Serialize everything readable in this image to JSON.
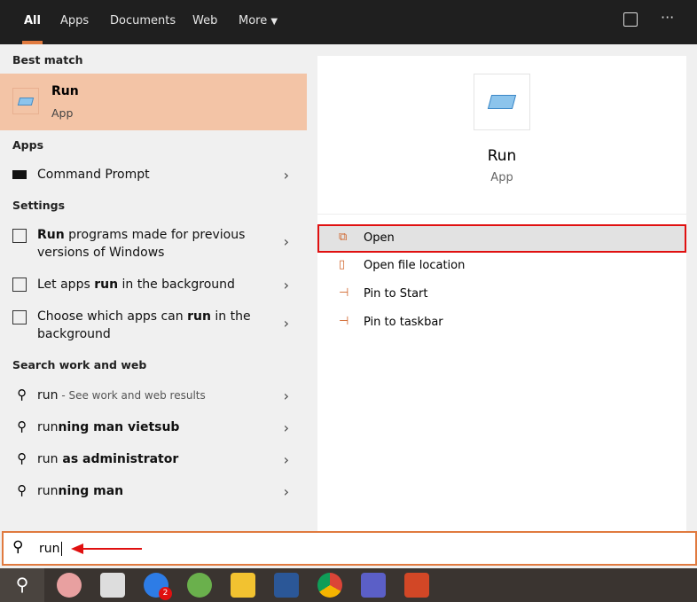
{
  "tabs": [
    "All",
    "Apps",
    "Documents",
    "Web",
    "More"
  ],
  "best_match": {
    "header": "Best match",
    "title": "Run",
    "subtitle": "App"
  },
  "apps": {
    "header": "Apps",
    "items": [
      {
        "label": "Command Prompt"
      }
    ]
  },
  "settings": {
    "header": "Settings",
    "items": [
      {
        "bold": "Run",
        "rest": " programs made for previous",
        "line2": "versions of Windows"
      },
      {
        "pre": "Let apps ",
        "bold": "run",
        "rest": " in the background"
      },
      {
        "pre": "Choose which apps can ",
        "bold": "run",
        "rest": " in the",
        "line2": "background"
      }
    ]
  },
  "web": {
    "header": "Search work and web",
    "items": [
      {
        "pre": "run",
        "bold": "",
        "hint": " - See work and web results"
      },
      {
        "pre": "run",
        "bold": "ning man vietsub"
      },
      {
        "pre": "run",
        "bold": " as administrator"
      },
      {
        "pre": "run",
        "bold": "ning man"
      }
    ]
  },
  "preview": {
    "title": "Run",
    "subtitle": "App",
    "actions": [
      "Open",
      "Open file location",
      "Pin to Start",
      "Pin to taskbar"
    ]
  },
  "search": {
    "value": "run"
  },
  "taskbar": {
    "zalo_badge": "2"
  },
  "colors": {
    "accent": "#e07a3f",
    "highlight": "#f3c4a6",
    "annotation": "#e01010"
  }
}
